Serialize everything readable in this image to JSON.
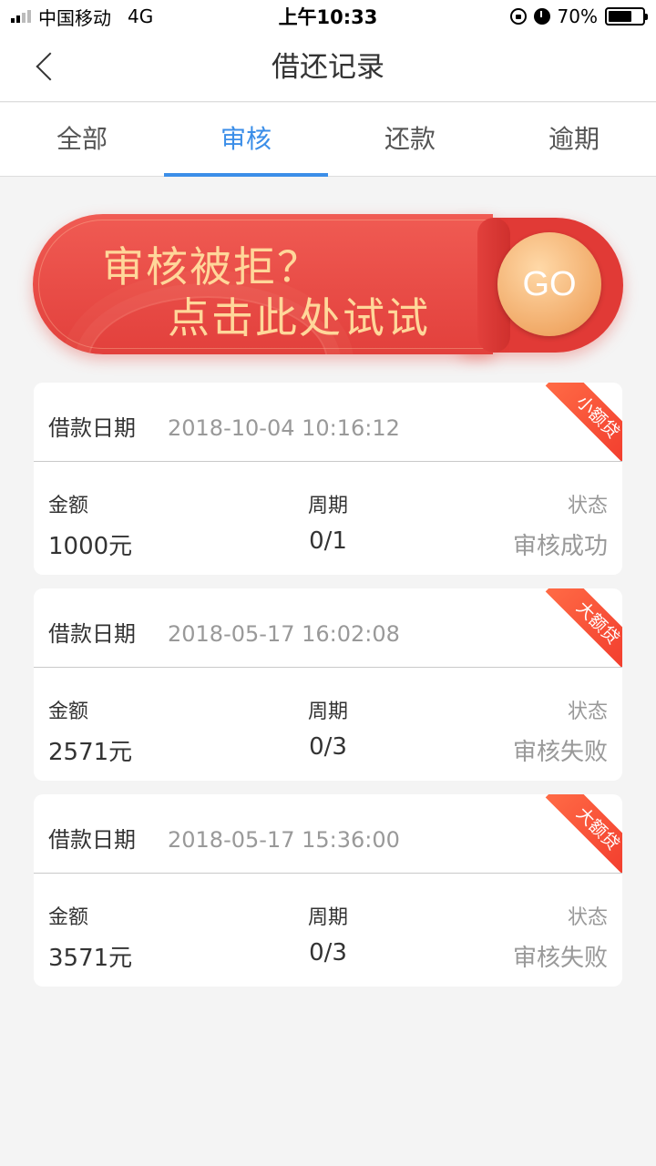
{
  "status_bar": {
    "carrier": "中国移动",
    "network": "4G",
    "time": "上午10:33",
    "battery": "70%",
    "battery_level": 0.7
  },
  "header": {
    "title": "借还记录"
  },
  "tabs": [
    {
      "label": "全部",
      "active": false
    },
    {
      "label": "审核",
      "active": true
    },
    {
      "label": "还款",
      "active": false
    },
    {
      "label": "逾期",
      "active": false
    }
  ],
  "accent_color": "#3b8ee8",
  "banner": {
    "line1": "审核被拒？",
    "line2": "点击此处试试",
    "button": "GO"
  },
  "labels": {
    "date": "借款日期",
    "amount": "金额",
    "period": "周期",
    "status": "状态"
  },
  "records": [
    {
      "date": "2018-10-04 10:16:12",
      "tag": "小额贷",
      "amount": "1000元",
      "period": "0/1",
      "status": "审核成功"
    },
    {
      "date": "2018-05-17 16:02:08",
      "tag": "大额贷",
      "amount": "2571元",
      "period": "0/3",
      "status": "审核失败"
    },
    {
      "date": "2018-05-17 15:36:00",
      "tag": "大额贷",
      "amount": "3571元",
      "period": "0/3",
      "status": "审核失败"
    }
  ]
}
